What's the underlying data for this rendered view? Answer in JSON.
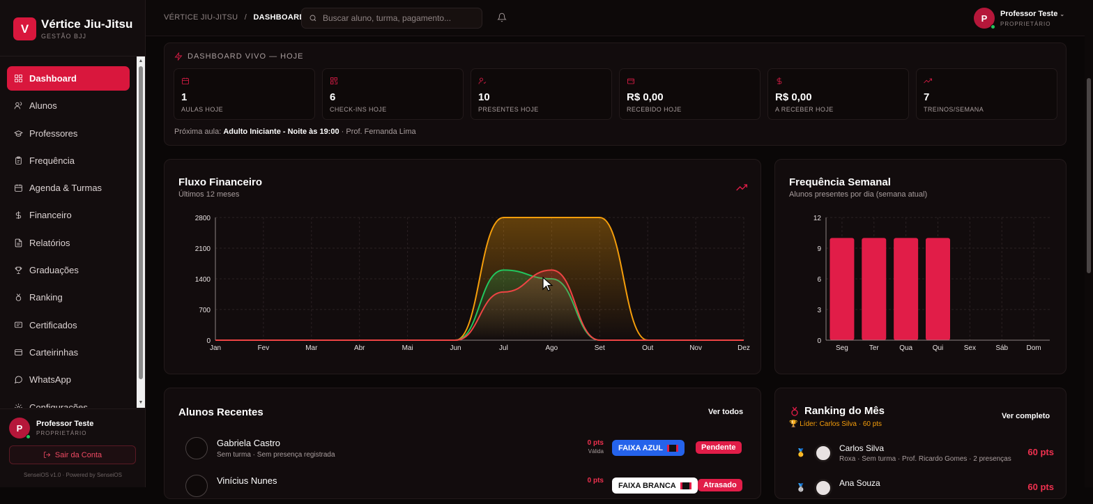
{
  "brand": {
    "initial": "V",
    "name": "Vértice Jiu-Jitsu",
    "subtitle": "GESTÃO BJJ"
  },
  "nav": [
    {
      "label": "Dashboard",
      "icon": "dashboard-icon",
      "active": true
    },
    {
      "label": "Alunos",
      "icon": "users-icon"
    },
    {
      "label": "Professores",
      "icon": "graduation-cap-icon"
    },
    {
      "label": "Frequência",
      "icon": "clipboard-icon"
    },
    {
      "label": "Agenda & Turmas",
      "icon": "calendar-icon"
    },
    {
      "label": "Financeiro",
      "icon": "dollar-icon"
    },
    {
      "label": "Relatórios",
      "icon": "report-icon"
    },
    {
      "label": "Graduações",
      "icon": "trophy-icon"
    },
    {
      "label": "Ranking",
      "icon": "medal-icon"
    },
    {
      "label": "Certificados",
      "icon": "certificate-icon"
    },
    {
      "label": "Carteirinhas",
      "icon": "id-card-icon"
    },
    {
      "label": "WhatsApp",
      "icon": "chat-icon"
    },
    {
      "label": "Configurações",
      "icon": "gear-icon"
    }
  ],
  "sidebar_user": {
    "initial": "P",
    "name": "Professor Teste",
    "role": "PROPRIETÁRIO",
    "logout": "Sair da Conta",
    "version": "SenseiOS v1.0 · Powered by SenseiOS"
  },
  "topbar": {
    "crumb_root": "VÉRTICE JIU-JITSU",
    "crumb_sep": "/",
    "crumb_current": "DASHBOARD",
    "search_placeholder": "Buscar aluno, turma, pagamento...",
    "user_initial": "P",
    "user_name": "Professor Teste",
    "user_role": "PROPRIETÁRIO"
  },
  "live": {
    "title": "DASHBOARD VIVO — HOJE",
    "stats": [
      {
        "value": "1",
        "label": "AULAS HOJE",
        "icon": "calendar-icon"
      },
      {
        "value": "6",
        "label": "CHECK-INS HOJE",
        "icon": "qr-code-icon"
      },
      {
        "value": "10",
        "label": "PRESENTES HOJE",
        "icon": "user-check-icon"
      },
      {
        "value": "R$ 0,00",
        "label": "RECEBIDO HOJE",
        "icon": "wallet-icon"
      },
      {
        "value": "R$ 0,00",
        "label": "A RECEBER HOJE",
        "icon": "dollar-icon"
      },
      {
        "value": "7",
        "label": "TREINOS/SEMANA",
        "icon": "trending-up-icon"
      }
    ],
    "next_prefix": "Próxima aula:",
    "next_class": "Adulto Iniciante - Noite às 19:00",
    "next_suffix": "· Prof. Fernanda Lima"
  },
  "finance": {
    "title": "Fluxo Financeiro",
    "subtitle": "Últimos 12 meses"
  },
  "weekly": {
    "title": "Frequência Semanal",
    "subtitle": "Alunos presentes por dia (semana atual)"
  },
  "chart_data": [
    {
      "type": "area",
      "title": "Fluxo Financeiro",
      "categories": [
        "Jan",
        "Fev",
        "Mar",
        "Abr",
        "Mai",
        "Jun",
        "Jul",
        "Ago",
        "Set",
        "Out",
        "Nov",
        "Dez"
      ],
      "ylim": [
        0,
        2800
      ],
      "yticks": [
        0,
        700,
        1400,
        2100,
        2800
      ],
      "grid": true,
      "series": [
        {
          "color": "#f59e0b",
          "values": [
            0,
            0,
            0,
            0,
            0,
            0,
            2800,
            2800,
            2800,
            0,
            0,
            0
          ]
        },
        {
          "color": "#22c55e",
          "values": [
            0,
            0,
            0,
            0,
            0,
            0,
            1600,
            1400,
            0,
            0,
            0,
            0
          ]
        },
        {
          "color": "#ef4444",
          "values": [
            0,
            0,
            0,
            0,
            0,
            0,
            1100,
            1600,
            0,
            0,
            0,
            0
          ]
        }
      ]
    },
    {
      "type": "bar",
      "title": "Frequência Semanal",
      "categories": [
        "Seg",
        "Ter",
        "Qua",
        "Qui",
        "Sex",
        "Sáb",
        "Dom"
      ],
      "values": [
        10,
        10,
        10,
        10,
        0,
        0,
        0
      ],
      "ylim": [
        0,
        12
      ],
      "yticks": [
        0,
        3,
        6,
        9,
        12
      ],
      "color": "#e11d48",
      "grid": true
    }
  ],
  "recent": {
    "title": "Alunos Recentes",
    "link": "Ver todos",
    "rows": [
      {
        "name": "Gabriela Castro",
        "sub": "Sem turma · Sem presença registrada",
        "pts": "0 pts",
        "validity": "Válida",
        "belt": "FAIXA AZUL",
        "belt_color": "#2563eb",
        "belt_text": "#ffffff",
        "status": "Pendente"
      },
      {
        "name": "Vinícius Nunes",
        "sub": "",
        "pts": "0 pts",
        "validity": "",
        "belt": "FAIXA BRANCA",
        "belt_color": "#ffffff",
        "belt_text": "#111111",
        "status": "Atrasado"
      }
    ]
  },
  "ranking": {
    "title": "Ranking do Mês",
    "leader": "🏆 Líder: Carlos Silva · 60 pts",
    "link": "Ver completo",
    "rows": [
      {
        "medal": "🥇",
        "name": "Carlos Silva",
        "sub": "Roxa · Sem turma · Prof. Ricardo Gomes · 2 presenças",
        "pts": "60 pts"
      },
      {
        "medal": "🥈",
        "name": "Ana Souza",
        "sub": "",
        "pts": "60 pts"
      }
    ]
  }
}
